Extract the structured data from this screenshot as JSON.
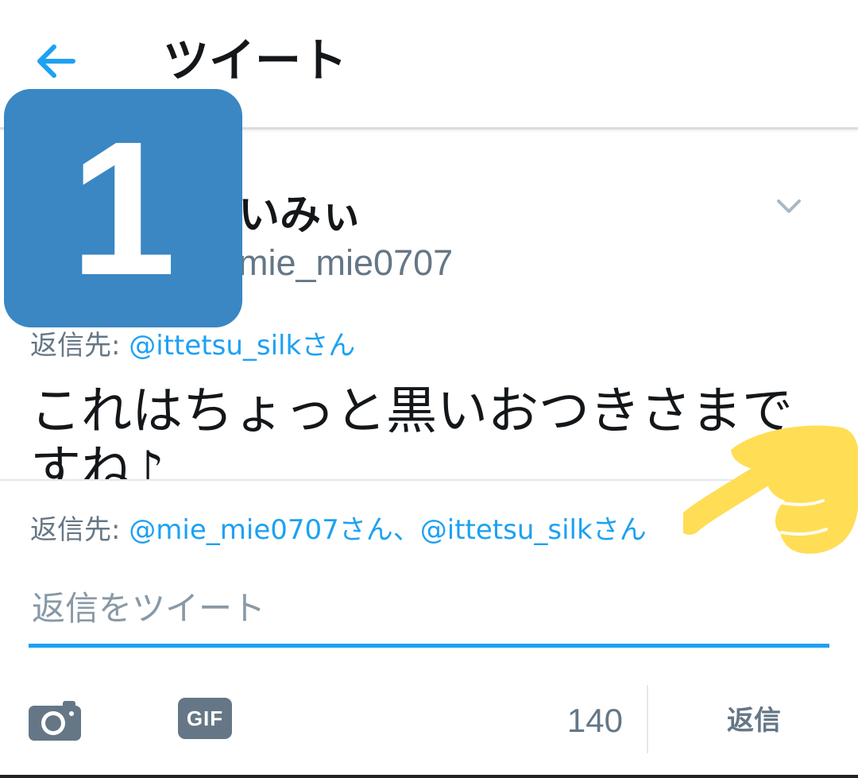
{
  "header": {
    "title": "ツイート",
    "back_icon": "arrow-left-icon"
  },
  "tweet": {
    "author_name": "いみぃ",
    "author_handle": "mie_mie0707",
    "reply_to_prefix": "返信先:",
    "reply_to_mentions": "@ittetsu_silkさん",
    "text": "これはちょっと黒いおつきさまですね♪"
  },
  "composer": {
    "reply_to_prefix": "返信先:",
    "reply_to_mentions": "@mie_mie0707さん、@ittetsu_silkさん",
    "placeholder": "返信をツイート",
    "gif_label": "GIF",
    "char_count": "140",
    "reply_button": "返信"
  },
  "overlay": {
    "step_number": "1"
  },
  "colors": {
    "accent": "#1da1f2",
    "secondary_text": "#657786",
    "badge": "#3a87c3",
    "hand": "#ffdd55"
  }
}
